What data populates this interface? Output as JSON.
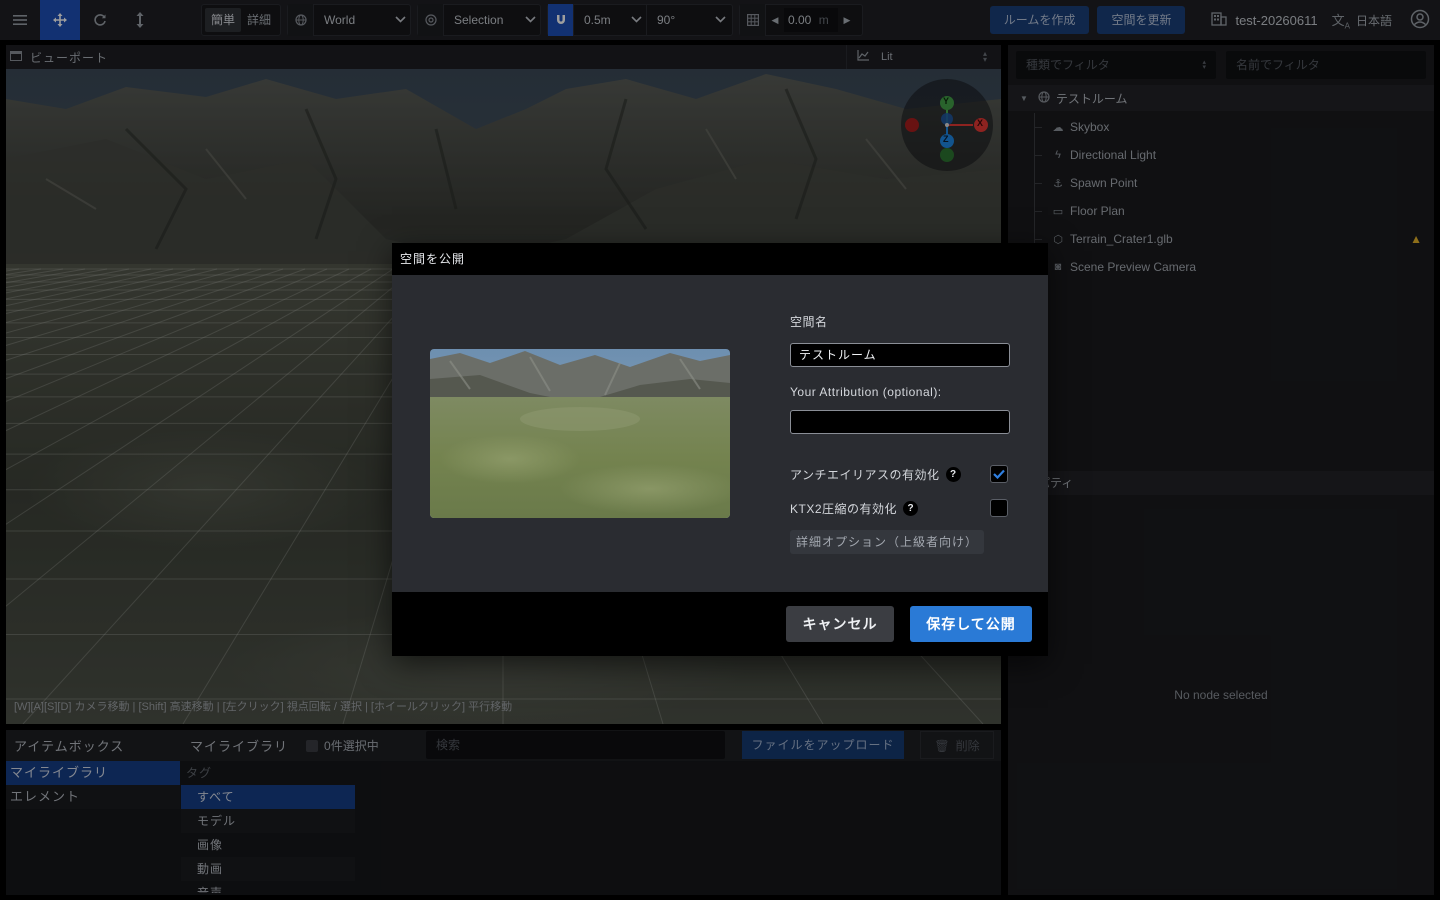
{
  "toolbar": {
    "menu_icon": "hamburger-icon",
    "transform_tools": [
      "move-icon",
      "rotate-icon",
      "scale-icon"
    ],
    "mode_simple": "簡単",
    "mode_detail": "詳細",
    "space": "World",
    "pivot": "Selection",
    "snap_distance": "0.5m",
    "snap_angle": "90°",
    "grid_value": "0.00",
    "grid_unit": "m",
    "create_room": "ルームを作成",
    "update_space": "空間を更新",
    "project_name": "test-20260611",
    "language": "日本語",
    "accent_color": "#1d4fb8"
  },
  "viewport": {
    "title": "ビューポート",
    "shading": "Lit",
    "hint": "[W][A][S][D] カメラ移動 | [Shift] 高速移動 | [左クリック] 視点回転 / 選択 | [ホイールクリック] 平行移動",
    "gizmo": {
      "y": "Y",
      "x": "X",
      "z": "Z"
    }
  },
  "itembox": {
    "title": "アイテムボックス",
    "library": "マイライブラリ",
    "selected_count": "0件選択中",
    "search_placeholder": "検索",
    "upload": "ファイルをアップロード",
    "delete": "削除",
    "nav": [
      "マイライブラリ",
      "エレメント"
    ],
    "tag_header": "タグ",
    "tags": [
      "すべて",
      "モデル",
      "画像",
      "動画",
      "音声"
    ]
  },
  "hierarchy": {
    "filter_type": "種類でフィルタ",
    "filter_name": "名前でフィルタ",
    "root": "テストルーム",
    "nodes": [
      {
        "label": "Skybox",
        "icon": "cloud-icon"
      },
      {
        "label": "Directional Light",
        "icon": "bolt-icon"
      },
      {
        "label": "Spawn Point",
        "icon": "spawn-icon"
      },
      {
        "label": "Floor Plan",
        "icon": "floorplan-icon"
      },
      {
        "label": "Terrain_Crater1.glb",
        "icon": "model-icon",
        "warning": true
      },
      {
        "label": "Scene Preview Camera",
        "icon": "camera-icon"
      }
    ],
    "properties_title": "プロパティ",
    "no_selection": "No node selected"
  },
  "dialog": {
    "title": "空間を公開",
    "name_label": "空間名",
    "name_value": "テストルーム",
    "attribution_label": "Your Attribution (optional):",
    "attribution_value": "",
    "antialias_label": "アンチエイリアスの有効化",
    "antialias_checked": true,
    "ktx2_label": "KTX2圧縮の有効化",
    "ktx2_checked": false,
    "help_mark": "?",
    "advanced": "詳細オプション（上級者向け）",
    "cancel": "キャンセル",
    "save_publish": "保存して公開",
    "primary_color": "#2a7ad6"
  }
}
